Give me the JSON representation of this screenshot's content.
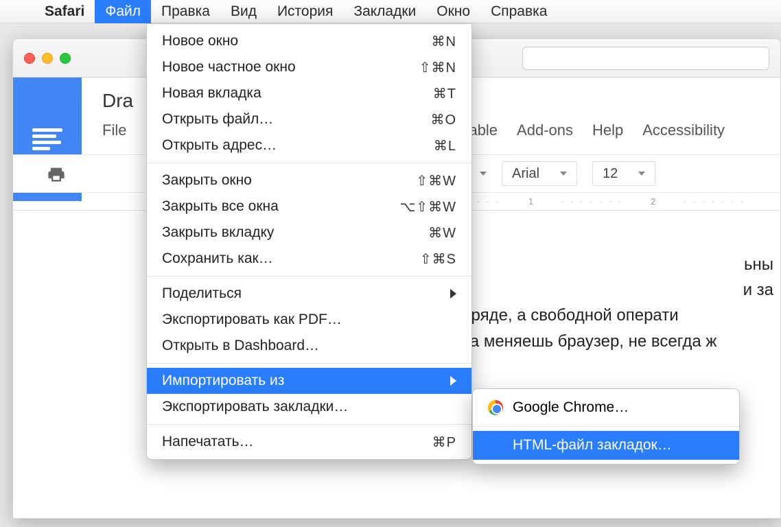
{
  "menubar": {
    "app": "Safari",
    "items": [
      "Файл",
      "Правка",
      "Вид",
      "История",
      "Закладки",
      "Окно",
      "Справка"
    ]
  },
  "dropdown": {
    "group1": [
      {
        "label": "Новое окно",
        "shortcut": "⌘N"
      },
      {
        "label": "Новое частное окно",
        "shortcut": "⇧⌘N"
      },
      {
        "label": "Новая вкладка",
        "shortcut": "⌘T"
      },
      {
        "label": "Открыть файл…",
        "shortcut": "⌘O"
      },
      {
        "label": "Открыть адрес…",
        "shortcut": "⌘L"
      }
    ],
    "group2": [
      {
        "label": "Закрыть окно",
        "shortcut": "⇧⌘W"
      },
      {
        "label": "Закрыть все окна",
        "shortcut": "⌥⇧⌘W"
      },
      {
        "label": "Закрыть вкладку",
        "shortcut": "⌘W"
      },
      {
        "label": "Сохранить как…",
        "shortcut": "⇧⌘S"
      }
    ],
    "group3": [
      {
        "label": "Поделиться",
        "submenu": true
      },
      {
        "label": "Экспортировать как PDF…"
      },
      {
        "label": "Открыть в Dashboard…"
      }
    ],
    "group4": [
      {
        "label": "Импортировать из",
        "submenu": true,
        "highlight": true
      },
      {
        "label": "Экспортировать закладки…"
      }
    ],
    "group5": [
      {
        "label": "Напечатать…",
        "shortcut": "⌘P"
      }
    ]
  },
  "submenu": {
    "items": [
      {
        "label": "Google Chrome…",
        "icon": "chrome"
      },
      {
        "label": "HTML-файл закладок…",
        "highlight": true
      }
    ]
  },
  "docs": {
    "title_partial": "Dra",
    "menu": [
      "File",
      "Table",
      "Add-ons",
      "Help",
      "Accessibility"
    ],
    "font": "Arial",
    "size": "12",
    "ruler": [
      "1",
      "2"
    ],
    "body_lines": [
      "ьны",
      "и за",
      "м заряде, а свободной операти",
      "когда меняешь браузер, не всегда ж"
    ]
  }
}
